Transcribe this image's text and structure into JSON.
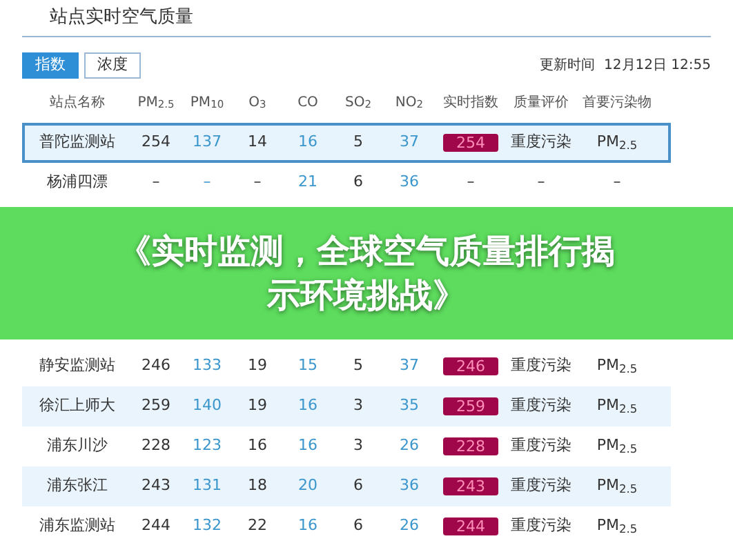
{
  "header": {
    "title": "站点实时空气质量"
  },
  "toggle": [
    {
      "label": "指数",
      "selected": true
    },
    {
      "label": "浓度",
      "selected": false
    }
  ],
  "update_time": "更新时间  12月12日 12:55",
  "table": {
    "columns": [
      {
        "label": "站点名称",
        "kind": "name"
      },
      {
        "label": "PM$_{2.5}$",
        "kind": "plain"
      },
      {
        "label": "PM$_{10}$",
        "kind": "link"
      },
      {
        "label": "O$_{3}$",
        "kind": "plain"
      },
      {
        "label": "CO",
        "kind": "link"
      },
      {
        "label": "SO$_{2}$",
        "kind": "plain"
      },
      {
        "label": "NO$_{2}$",
        "kind": "link"
      },
      {
        "label": "实时指数",
        "kind": "badge"
      },
      {
        "label": "质量评价",
        "kind": "plain"
      },
      {
        "label": "首要污染物",
        "kind": "plain"
      }
    ],
    "rows_top": [
      {
        "selected": true,
        "cells": [
          "普陀监测站",
          "254",
          "137",
          "14",
          "16",
          "5",
          "37",
          "254",
          "重度污染",
          "PM$_{2.5}$"
        ]
      },
      {
        "selected": false,
        "cells": [
          "杨浦四漂",
          "–",
          "–",
          "–",
          "21",
          "6",
          "36",
          "–",
          "–",
          "–"
        ]
      }
    ],
    "rows_bottom": [
      {
        "selected": false,
        "cells": [
          "静安监测站",
          "246",
          "133",
          "19",
          "15",
          "5",
          "37",
          "246",
          "重度污染",
          "PM$_{2.5}$"
        ]
      },
      {
        "selected": false,
        "cells": [
          "徐汇上师大",
          "259",
          "140",
          "19",
          "16",
          "3",
          "35",
          "259",
          "重度污染",
          "PM$_{2.5}$"
        ]
      },
      {
        "selected": false,
        "cells": [
          "浦东川沙",
          "228",
          "123",
          "16",
          "16",
          "3",
          "26",
          "228",
          "重度污染",
          "PM$_{2.5}$"
        ]
      },
      {
        "selected": false,
        "cells": [
          "浦东张江",
          "243",
          "131",
          "18",
          "20",
          "6",
          "36",
          "243",
          "重度污染",
          "PM$_{2.5}$"
        ]
      },
      {
        "selected": false,
        "cells": [
          "浦东监测站",
          "244",
          "132",
          "22",
          "16",
          "6",
          "26",
          "244",
          "重度污染",
          "PM$_{2.5}$"
        ]
      }
    ]
  },
  "banner": {
    "lines": [
      "《实时监测，全球空气质量排行揭",
      "示环境挑战》"
    ]
  }
}
